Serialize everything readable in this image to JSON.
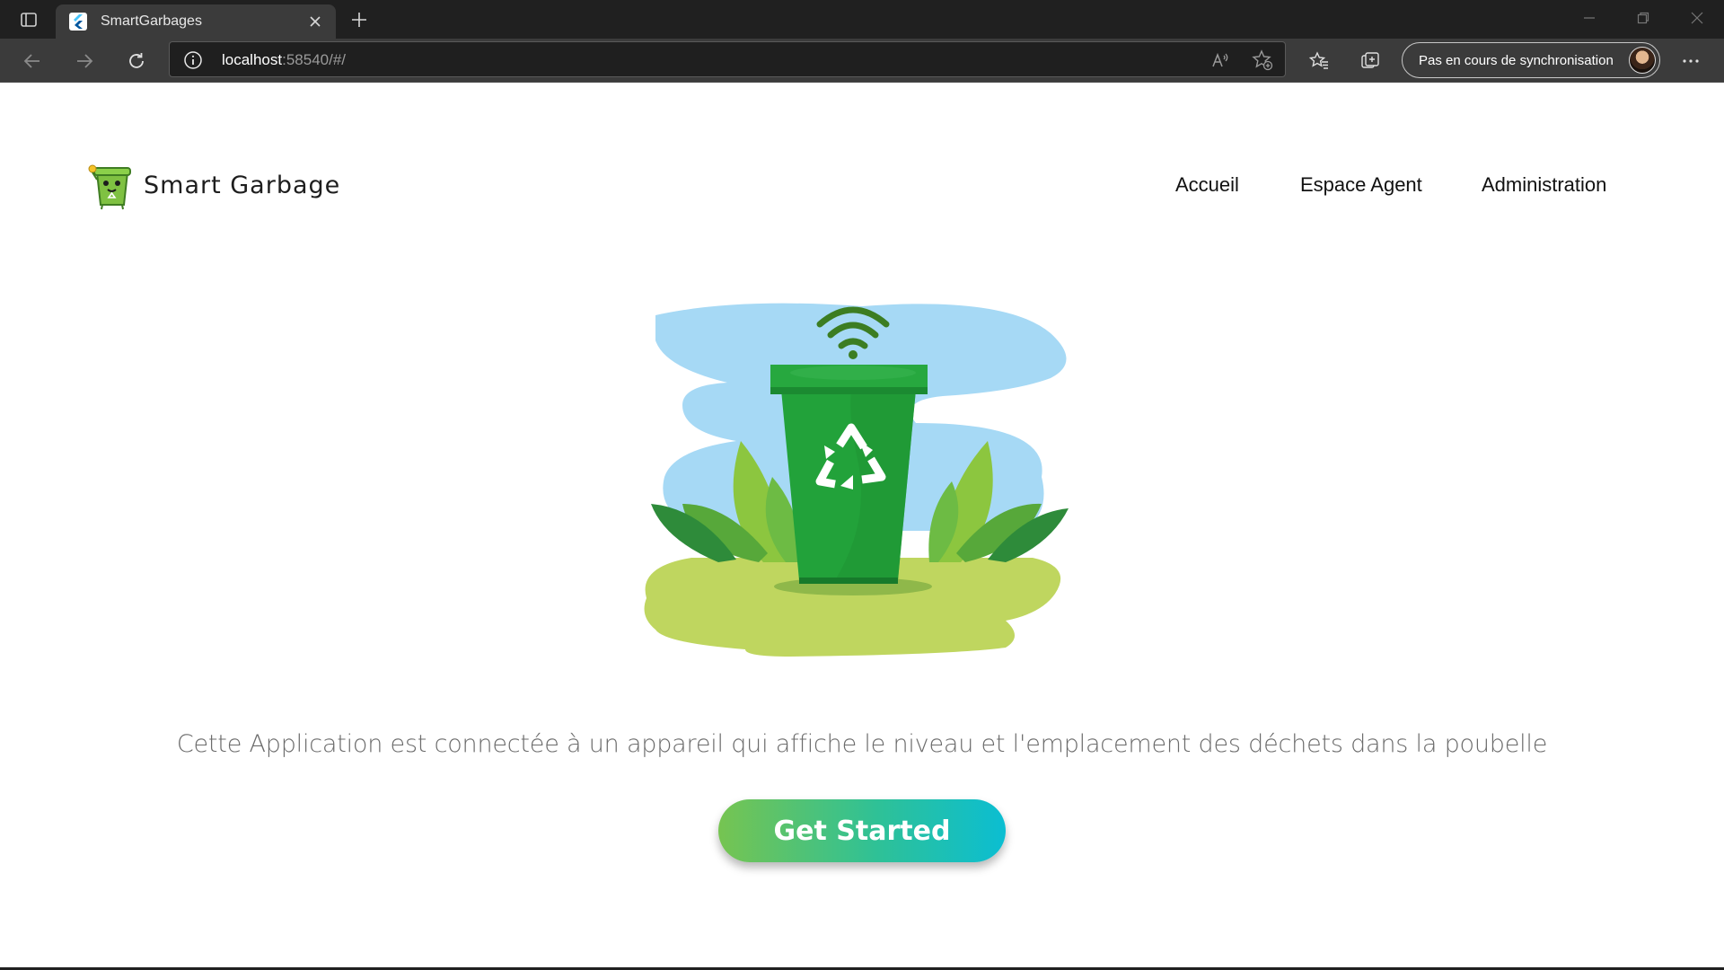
{
  "browser": {
    "tab_title": "SmartGarbages",
    "url_host": "localhost",
    "url_rest": ":58540/#/",
    "sync_label": "Pas en cours de synchronisation"
  },
  "header": {
    "brand_name": "Smart Garbage",
    "nav": [
      "Accueil",
      "Espace Agent",
      "Administration"
    ]
  },
  "main": {
    "description": "Cette Application est connectée à un appareil qui affiche le niveau et l'emplacement des déchets dans la poubelle",
    "cta_label": "Get Started"
  },
  "colors": {
    "chrome_dark": "#202020",
    "chrome_toolbar": "#3b3b3b",
    "bin_green": "#22a23a",
    "sky_blue": "#a6d9f5",
    "grass": "#bfd65f",
    "cta_start": "#76c451",
    "cta_end": "#0bbed2"
  }
}
